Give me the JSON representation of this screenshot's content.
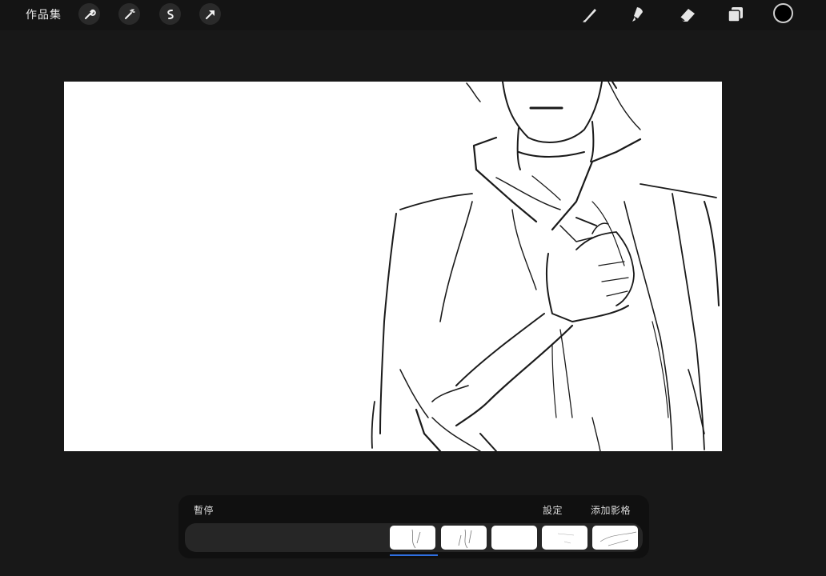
{
  "topbar": {
    "gallery_label": "作品集",
    "left_tools": [
      "wrench-icon",
      "magic-wand-icon",
      "selection-icon",
      "transform-arrow-icon"
    ],
    "right_tools": [
      "brush-icon",
      "smudge-icon",
      "eraser-icon",
      "layers-icon"
    ],
    "current_color": "#000000"
  },
  "timeline": {
    "pause_label": "暫停",
    "settings_label": "設定",
    "add_frame_label": "添加影格",
    "frame_count": 5,
    "selected_frame": 1
  },
  "colors": {
    "background": "#181818",
    "playhead": "#2f6fe0"
  }
}
